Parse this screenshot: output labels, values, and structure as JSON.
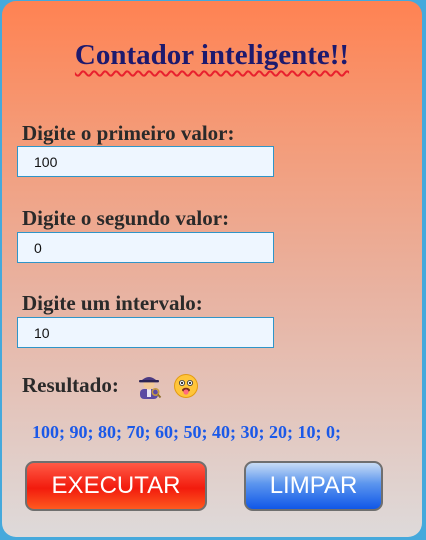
{
  "title": "Contador inteligente!!",
  "fields": [
    {
      "label": "Digite o primeiro valor:",
      "value": "100"
    },
    {
      "label": "Digite o segundo valor:",
      "value": "0"
    },
    {
      "label": "Digite um intervalo:",
      "value": "10"
    }
  ],
  "result": {
    "label": "Resultado:",
    "icons": [
      "detective-icon",
      "tongue-out-face-icon"
    ],
    "output": "100; 90; 80; 70; 60; 50; 40; 30; 20; 10; 0;"
  },
  "buttons": {
    "execute_label": "EXECUTAR",
    "clear_label": "LIMPAR"
  },
  "colors": {
    "title": "#1d1a6e",
    "title_underline": "#e8212e",
    "output": "#1b59e8",
    "execute_button": "#f21b0d",
    "clear_button": "#1057e8",
    "field_border": "#2f95c8",
    "page_background": "#45a9dc"
  }
}
